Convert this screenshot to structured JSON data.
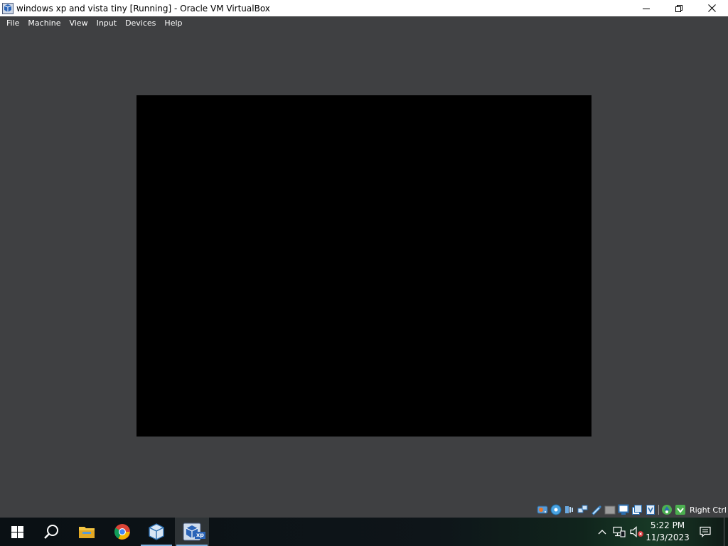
{
  "window": {
    "title": "windows xp and vista tiny [Running] - Oracle VM VirtualBox",
    "controls": [
      "minimize-icon",
      "restore-icon",
      "close-icon"
    ]
  },
  "menu": {
    "items": [
      "File",
      "Machine",
      "View",
      "Input",
      "Devices",
      "Help"
    ]
  },
  "statusbar": {
    "icons": [
      "hard-disk-icon",
      "optical-disk-icon",
      "audio-icon",
      "network-icon",
      "usb-icon",
      "shared-folders-icon",
      "display-icon",
      "recording-icon",
      "cpu-icon",
      "mouse-integration-icon",
      "keyboard-icon"
    ],
    "host_key": "Right Ctrl"
  },
  "taskbar": {
    "apps": [
      "start-icon",
      "search-icon",
      "file-explorer-icon",
      "chrome-icon",
      "virtualbox-manager-icon",
      "virtualbox-vm-icon"
    ],
    "vm_badge": "xp",
    "tray_icons": [
      "chevron-up-icon",
      "network-icon",
      "volume-muted-icon"
    ],
    "clock_time": "5:22 PM",
    "clock_date": "11/3/2023",
    "notification_icon": "action-center-icon"
  },
  "colors": {
    "window_background": "#3f4042",
    "titlebar": "#ffffff",
    "vm_screen": "#000000",
    "taskbar": "#0e1519",
    "active_indicator": "#7fb2e0"
  }
}
